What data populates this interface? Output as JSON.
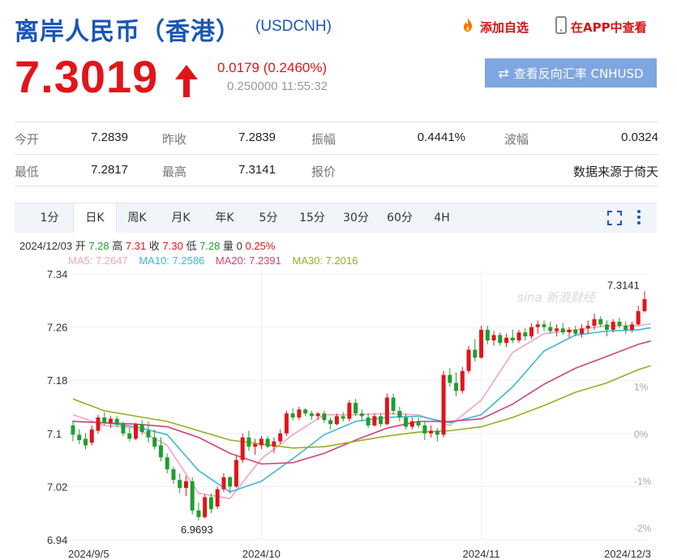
{
  "header": {
    "title": "离岸人民币（香港）",
    "code": "(USDCNH)",
    "add_favorite": "添加自选",
    "view_app": "在APP中查看"
  },
  "quote": {
    "price": "7.3019",
    "change": "0.0179 (0.2460%)",
    "sub": "0.250000 11:55:32",
    "reverse_button": "查看反向汇率 CNHUSD"
  },
  "stats": {
    "open_label": "今开",
    "open_value": "7.2839",
    "prev_close_label": "昨收",
    "prev_close_value": "7.2839",
    "amplitude_label": "振幅",
    "amplitude_value": "0.4441%",
    "wave_label": "波幅",
    "wave_value": "0.0324",
    "low_label": "最低",
    "low_value": "7.2817",
    "high_label": "最高",
    "high_value": "7.3141",
    "quote_label": "报价",
    "source_text": "数据来源于倚天"
  },
  "tabs": [
    "1分",
    "日K",
    "周K",
    "月K",
    "年K",
    "5分",
    "15分",
    "30分",
    "60分",
    "4H"
  ],
  "active_tab": "日K",
  "info_bar": {
    "date": "2024/12/03",
    "open_label": "开",
    "open": "7.28",
    "high_label": "高",
    "high": "7.31",
    "close_label": "收",
    "close": "7.30",
    "low_label": "低",
    "low": "7.28",
    "vol_label": "量",
    "vol": "0",
    "pct": "0.25%"
  },
  "ma_legend": [
    {
      "text": "MA5: 7.2647",
      "color": "#f0a6c4"
    },
    {
      "text": "MA10: 7.2586",
      "color": "#3fb6d8"
    },
    {
      "text": "MA20: 7.2391",
      "color": "#d2427a"
    },
    {
      "text": "MA30: 7.2016",
      "color": "#9aac24"
    }
  ],
  "colors": {
    "up": "#e0151a",
    "down": "#1e9e2f",
    "accent": "#1a56b8"
  },
  "chart_data": {
    "type": "candlestick",
    "y_ticks": [
      "7.34",
      "7.26",
      "7.18",
      "7.1",
      "7.02",
      "6.94"
    ],
    "y_tick_values": [
      7.34,
      7.26,
      7.18,
      7.1,
      7.02,
      6.94
    ],
    "pct_ticks": [
      "1%",
      "0%",
      "-1%",
      "-2%"
    ],
    "pct_tick_values": [
      1,
      0,
      -1,
      -2
    ],
    "pct_base": 7.1,
    "x_labels": [
      "2024/9/5",
      "2024/10",
      "2024/11",
      "2024/12/3"
    ],
    "x_label_index": [
      0,
      30,
      65,
      92
    ],
    "high_label": "7.3141",
    "low_label": "6.9693",
    "watermark": "sina 新浪财经",
    "candles": [
      [
        7.112,
        7.12,
        7.088,
        7.098
      ],
      [
        7.098,
        7.106,
        7.084,
        7.09
      ],
      [
        7.092,
        7.1,
        7.076,
        7.082
      ],
      [
        7.086,
        7.112,
        7.082,
        7.106
      ],
      [
        7.104,
        7.128,
        7.1,
        7.124
      ],
      [
        7.124,
        7.132,
        7.112,
        7.116
      ],
      [
        7.116,
        7.126,
        7.108,
        7.122
      ],
      [
        7.122,
        7.126,
        7.11,
        7.114
      ],
      [
        7.114,
        7.118,
        7.096,
        7.1
      ],
      [
        7.1,
        7.108,
        7.088,
        7.092
      ],
      [
        7.092,
        7.116,
        7.09,
        7.114
      ],
      [
        7.114,
        7.12,
        7.098,
        7.102
      ],
      [
        7.104,
        7.118,
        7.086,
        7.094
      ],
      [
        7.094,
        7.106,
        7.076,
        7.08
      ],
      [
        7.082,
        7.094,
        7.058,
        7.064
      ],
      [
        7.064,
        7.07,
        7.04,
        7.046
      ],
      [
        7.046,
        7.05,
        7.024,
        7.03
      ],
      [
        7.03,
        7.04,
        7.01,
        7.018
      ],
      [
        7.018,
        7.036,
        7.006,
        7.028
      ],
      [
        7.028,
        7.034,
        6.978,
        6.984
      ],
      [
        6.984,
        6.996,
        6.969,
        6.974
      ],
      [
        6.974,
        7.008,
        6.972,
        7.004
      ],
      [
        7.004,
        7.01,
        6.98,
        6.986
      ],
      [
        6.99,
        7.02,
        6.986,
        7.016
      ],
      [
        7.016,
        7.04,
        7.012,
        7.034
      ],
      [
        7.034,
        7.036,
        7.01,
        7.02
      ],
      [
        7.02,
        7.066,
        7.018,
        7.06
      ],
      [
        7.06,
        7.1,
        7.056,
        7.094
      ],
      [
        7.094,
        7.104,
        7.074,
        7.08
      ],
      [
        7.08,
        7.092,
        7.068,
        7.084
      ],
      [
        7.082,
        7.096,
        7.076,
        7.092
      ],
      [
        7.092,
        7.096,
        7.078,
        7.08
      ],
      [
        7.08,
        7.094,
        7.07,
        7.088
      ],
      [
        7.088,
        7.106,
        7.084,
        7.1
      ],
      [
        7.1,
        7.134,
        7.096,
        7.13
      ],
      [
        7.13,
        7.138,
        7.12,
        7.124
      ],
      [
        7.124,
        7.14,
        7.12,
        7.136
      ],
      [
        7.136,
        7.138,
        7.126,
        7.13
      ],
      [
        7.13,
        7.134,
        7.12,
        7.126
      ],
      [
        7.126,
        7.132,
        7.12,
        7.13
      ],
      [
        7.13,
        7.134,
        7.116,
        7.12
      ],
      [
        7.12,
        7.124,
        7.106,
        7.114
      ],
      [
        7.114,
        7.13,
        7.112,
        7.126
      ],
      [
        7.126,
        7.132,
        7.118,
        7.122
      ],
      [
        7.122,
        7.15,
        7.118,
        7.146
      ],
      [
        7.146,
        7.152,
        7.126,
        7.13
      ],
      [
        7.13,
        7.136,
        7.118,
        7.126
      ],
      [
        7.124,
        7.13,
        7.108,
        7.112
      ],
      [
        7.112,
        7.13,
        7.11,
        7.126
      ],
      [
        7.126,
        7.13,
        7.11,
        7.114
      ],
      [
        7.114,
        7.16,
        7.112,
        7.154
      ],
      [
        7.154,
        7.16,
        7.128,
        7.134
      ],
      [
        7.134,
        7.14,
        7.118,
        7.124
      ],
      [
        7.124,
        7.13,
        7.106,
        7.11
      ],
      [
        7.11,
        7.124,
        7.106,
        7.118
      ],
      [
        7.118,
        7.124,
        7.108,
        7.112
      ],
      [
        7.112,
        7.118,
        7.09,
        7.1
      ],
      [
        7.1,
        7.112,
        7.094,
        7.104
      ],
      [
        7.104,
        7.108,
        7.088,
        7.098
      ],
      [
        7.098,
        7.194,
        7.094,
        7.188
      ],
      [
        7.188,
        7.198,
        7.17,
        7.176
      ],
      [
        7.176,
        7.192,
        7.156,
        7.164
      ],
      [
        7.164,
        7.2,
        7.16,
        7.194
      ],
      [
        7.194,
        7.232,
        7.19,
        7.226
      ],
      [
        7.226,
        7.242,
        7.208,
        7.214
      ],
      [
        7.214,
        7.262,
        7.212,
        7.256
      ],
      [
        7.256,
        7.262,
        7.234,
        7.24
      ],
      [
        7.24,
        7.254,
        7.232,
        7.248
      ],
      [
        7.248,
        7.252,
        7.232,
        7.236
      ],
      [
        7.236,
        7.25,
        7.23,
        7.244
      ],
      [
        7.244,
        7.256,
        7.236,
        7.24
      ],
      [
        7.24,
        7.256,
        7.236,
        7.252
      ],
      [
        7.252,
        7.258,
        7.24,
        7.246
      ],
      [
        7.246,
        7.266,
        7.242,
        7.26
      ],
      [
        7.26,
        7.27,
        7.25,
        7.264
      ],
      [
        7.264,
        7.27,
        7.254,
        7.26
      ],
      [
        7.26,
        7.268,
        7.25,
        7.254
      ],
      [
        7.254,
        7.264,
        7.246,
        7.258
      ],
      [
        7.258,
        7.266,
        7.248,
        7.252
      ],
      [
        7.252,
        7.26,
        7.244,
        7.256
      ],
      [
        7.256,
        7.262,
        7.246,
        7.25
      ],
      [
        7.25,
        7.264,
        7.244,
        7.258
      ],
      [
        7.258,
        7.27,
        7.25,
        7.262
      ],
      [
        7.262,
        7.28,
        7.256,
        7.272
      ],
      [
        7.272,
        7.276,
        7.26,
        7.264
      ],
      [
        7.264,
        7.27,
        7.246,
        7.256
      ],
      [
        7.256,
        7.272,
        7.252,
        7.268
      ],
      [
        7.268,
        7.274,
        7.258,
        7.262
      ],
      [
        7.262,
        7.268,
        7.25,
        7.256
      ],
      [
        7.256,
        7.268,
        7.252,
        7.264
      ],
      [
        7.264,
        7.292,
        7.262,
        7.284
      ],
      [
        7.284,
        7.314,
        7.282,
        7.302
      ]
    ],
    "ma_series": [
      {
        "name": "MA5",
        "color": "#f0a6c4",
        "points": [
          [
            0,
            7.128
          ],
          [
            5,
            7.112
          ],
          [
            10,
            7.108
          ],
          [
            15,
            7.082
          ],
          [
            20,
            7.01
          ],
          [
            25,
            7.002
          ],
          [
            30,
            7.062
          ],
          [
            35,
            7.098
          ],
          [
            40,
            7.128
          ],
          [
            45,
            7.128
          ],
          [
            50,
            7.13
          ],
          [
            55,
            7.128
          ],
          [
            60,
            7.112
          ],
          [
            65,
            7.15
          ],
          [
            70,
            7.222
          ],
          [
            75,
            7.25
          ],
          [
            80,
            7.256
          ],
          [
            85,
            7.262
          ],
          [
            90,
            7.262
          ],
          [
            92,
            7.265
          ]
        ]
      },
      {
        "name": "MA10",
        "color": "#3fb6d8",
        "points": [
          [
            0,
            7.118
          ],
          [
            5,
            7.116
          ],
          [
            10,
            7.11
          ],
          [
            15,
            7.098
          ],
          [
            20,
            7.044
          ],
          [
            25,
            7.012
          ],
          [
            30,
            7.028
          ],
          [
            35,
            7.062
          ],
          [
            40,
            7.098
          ],
          [
            45,
            7.118
          ],
          [
            50,
            7.124
          ],
          [
            55,
            7.126
          ],
          [
            60,
            7.116
          ],
          [
            65,
            7.128
          ],
          [
            70,
            7.17
          ],
          [
            75,
            7.224
          ],
          [
            80,
            7.248
          ],
          [
            85,
            7.254
          ],
          [
            90,
            7.256
          ],
          [
            92,
            7.259
          ]
        ]
      },
      {
        "name": "MA20",
        "color": "#d2427a",
        "points": [
          [
            0,
            7.118
          ],
          [
            5,
            7.116
          ],
          [
            10,
            7.114
          ],
          [
            15,
            7.11
          ],
          [
            20,
            7.094
          ],
          [
            25,
            7.07
          ],
          [
            30,
            7.054
          ],
          [
            35,
            7.056
          ],
          [
            40,
            7.07
          ],
          [
            45,
            7.09
          ],
          [
            50,
            7.108
          ],
          [
            55,
            7.118
          ],
          [
            60,
            7.118
          ],
          [
            65,
            7.122
          ],
          [
            70,
            7.144
          ],
          [
            75,
            7.174
          ],
          [
            80,
            7.198
          ],
          [
            85,
            7.216
          ],
          [
            90,
            7.234
          ],
          [
            92,
            7.239
          ]
        ]
      },
      {
        "name": "MA30",
        "color": "#9aac24",
        "points": [
          [
            0,
            7.152
          ],
          [
            5,
            7.134
          ],
          [
            10,
            7.126
          ],
          [
            15,
            7.118
          ],
          [
            20,
            7.104
          ],
          [
            25,
            7.09
          ],
          [
            30,
            7.084
          ],
          [
            35,
            7.078
          ],
          [
            40,
            7.08
          ],
          [
            45,
            7.088
          ],
          [
            50,
            7.096
          ],
          [
            55,
            7.102
          ],
          [
            60,
            7.104
          ],
          [
            65,
            7.11
          ],
          [
            70,
            7.124
          ],
          [
            75,
            7.142
          ],
          [
            80,
            7.162
          ],
          [
            85,
            7.176
          ],
          [
            90,
            7.196
          ],
          [
            92,
            7.202
          ]
        ]
      }
    ]
  }
}
